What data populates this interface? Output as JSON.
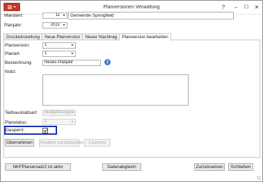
{
  "window": {
    "title": "Planversionen Verwaltung",
    "menu_icon": "hamburger-menu-icon",
    "help_label": "?",
    "minimize_label": "–",
    "maximize_label": "☐",
    "close_label": "✕",
    "accent_color": "#c0392b"
  },
  "header": {
    "mandant_label": "Mandant:",
    "mandant_value": "11",
    "mandant_name": "Gemeinde Springfield",
    "planjahr_label": "Planjahr:",
    "planjahr_value": "2022"
  },
  "tabs": [
    {
      "label": "Druckeinstellung",
      "active": false
    },
    {
      "label": "Neue Planversion",
      "active": false
    },
    {
      "label": "Neuer Nachtrag",
      "active": false
    },
    {
      "label": "Planversion bearbeiten",
      "active": true
    }
  ],
  "form": {
    "planversion_label": "Planversion:",
    "planversion_value": "1",
    "planart_label": "Planart:",
    "planart_value": "1",
    "bezeichnung_label": "Bezeichnung:",
    "bezeichnung_value": "Neues Planjahr",
    "info_icon": "info-icon",
    "notiz_label": "Notiz:",
    "notiz_value": "",
    "teilhaushaltsart_label": "Teilhaushaltsart:",
    "teilhaushaltsart_value": "Budgetbezogen",
    "planstatus_label": "Planstatus:",
    "planstatus_value": "1",
    "gesperrt_label": "Gesperrt:",
    "gesperrt_checked": true,
    "highlight_color": "#1c2fb0"
  },
  "panel_buttons": {
    "uebernehmen": "Übernehmen",
    "ansaetze_zuruecksetzen": "Ansätze zurücksetzen",
    "loeschen": "Löschen"
  },
  "footer": {
    "status_button": "NKFPlanansatz2 ist aktiv",
    "datenabgleich": "Datenabgleich",
    "zuruecksetzen": "Zurücksetzen",
    "schliessen": "Schließen"
  }
}
